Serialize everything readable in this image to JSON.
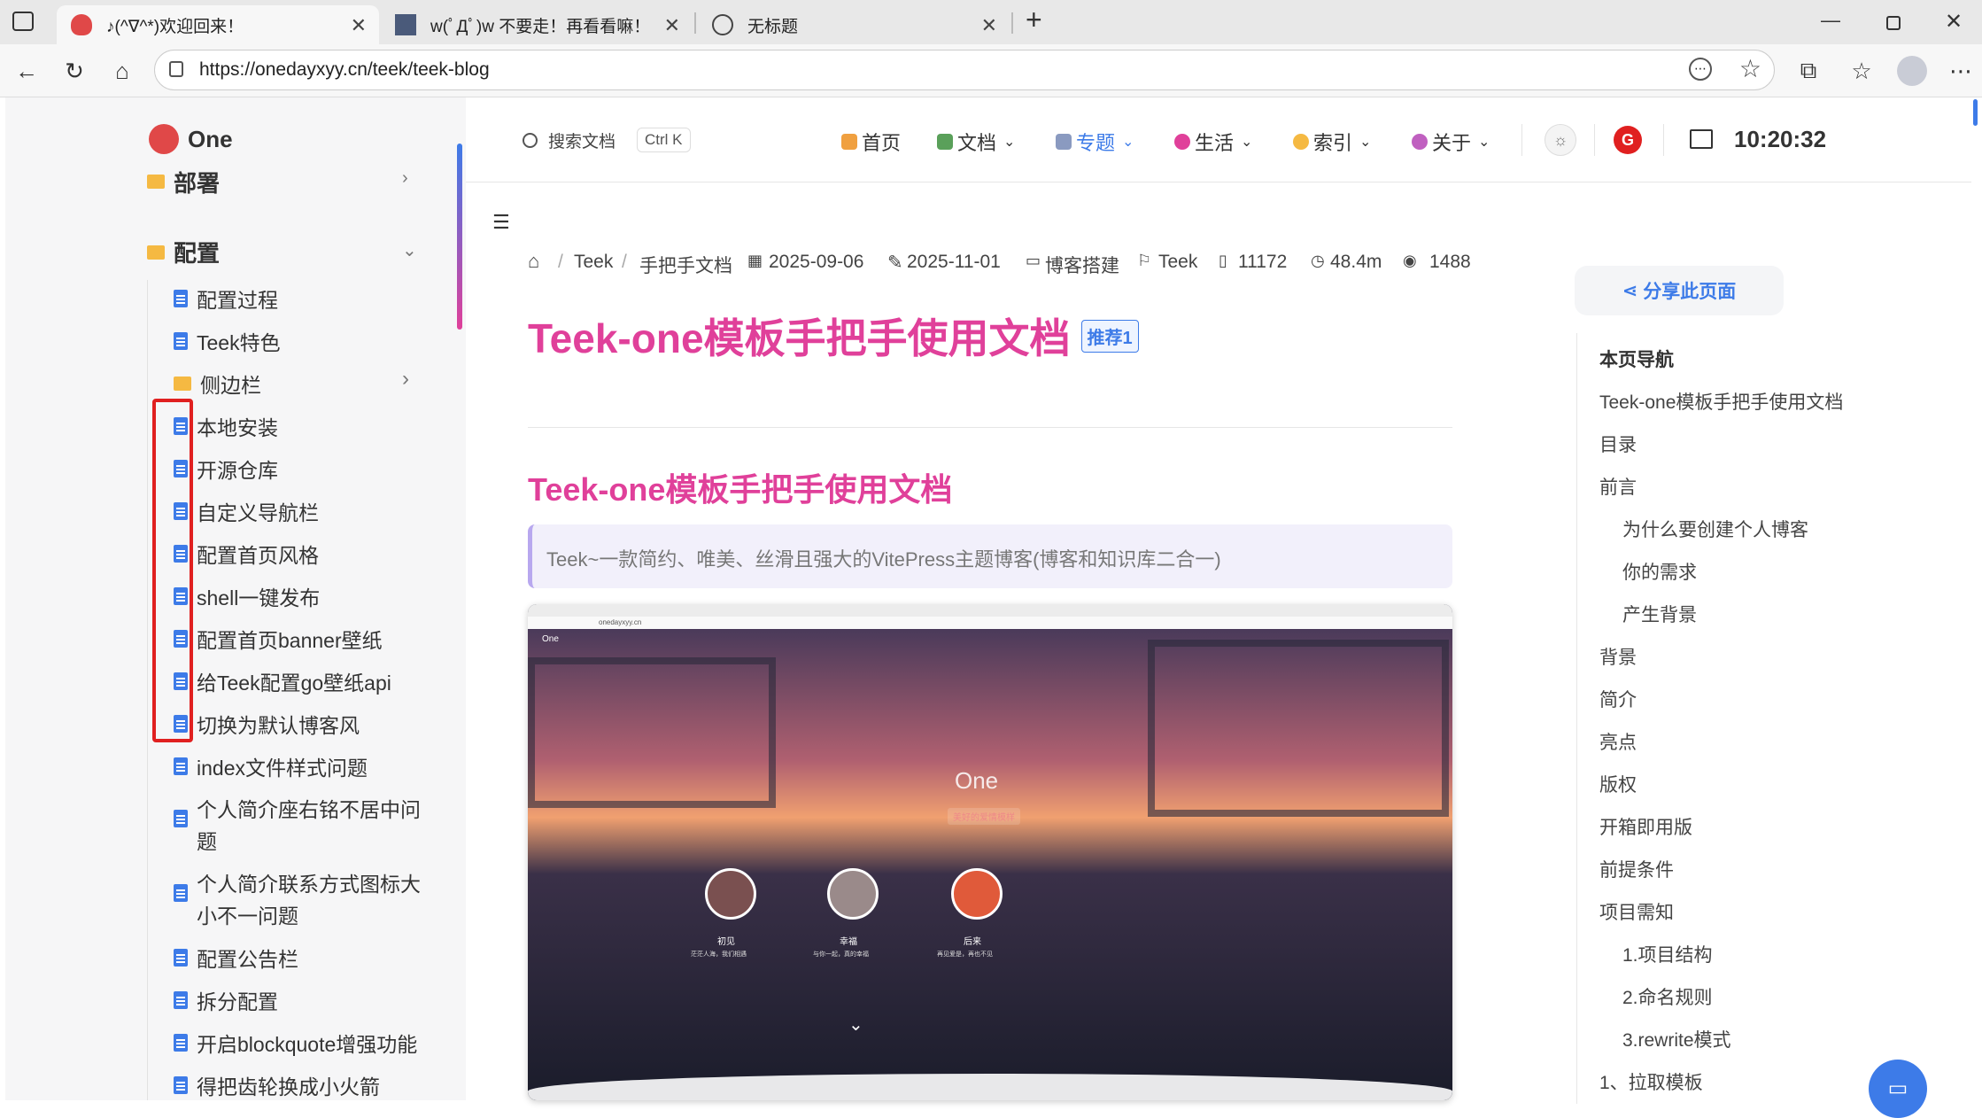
{
  "tabs": [
    {
      "title": "♪(^∇^*)欢迎回来！"
    },
    {
      "title": "w(ﾟДﾟ)w 不要走！再看看嘛！"
    },
    {
      "title": "无标题"
    }
  ],
  "url": "https://onedayxyy.cn/teek/teek-blog",
  "site": {
    "name": "One"
  },
  "sidebar": {
    "partial": "部署",
    "group": "配置",
    "items": [
      "配置过程",
      "Teek特色",
      "侧边栏",
      "本地安装",
      "开源仓库",
      "自定义导航栏",
      "配置首页风格",
      "shell一键发布",
      "配置首页banner壁纸",
      "给Teek配置go壁纸api",
      "切换为默认博客风",
      "index文件样式问题",
      "个人简介座右铭不居中问",
      "题",
      "个人简介联系方式图标大",
      "小不一问题",
      "配置公告栏",
      "拆分配置",
      "开启blockquote增强功能",
      "得把齿轮换成小火箭"
    ]
  },
  "header": {
    "search": "搜索文档",
    "shortcut": "Ctrl K",
    "nav": [
      "首页",
      "文档",
      "专题",
      "生活",
      "索引",
      "关于"
    ],
    "time": "10:20:32"
  },
  "breadcrumb": {
    "a": "Teek",
    "b": "手把手文档"
  },
  "meta": {
    "created": "2025-09-06",
    "updated": "2025-11-01",
    "category": "博客搭建",
    "tag": "Teek",
    "words": "11172",
    "read": "48.4m",
    "views": "1488"
  },
  "article": {
    "title": "Teek-one模板手把手使用文档",
    "badge": "推荐1",
    "h2": "Teek-one模板手把手使用文档",
    "quote": "Teek~一款简约、唯美、丝滑且强大的VitePress主题博客(博客和知识库二合一)",
    "shot": {
      "site": "One",
      "url": "onedayxyy.cn",
      "hero": "One",
      "sub": "美好的爱情模样",
      "cards": [
        {
          "t": "初见",
          "d": "茫茫人海，我们相遇"
        },
        {
          "t": "幸福",
          "d": "与你一起，真的幸福"
        },
        {
          "t": "后来",
          "d": "再见爱是，再也不见"
        }
      ]
    }
  },
  "share": "分享此页面",
  "toc": {
    "title": "本页导航",
    "items": [
      "Teek-one模板手把手使用文档",
      "目录",
      "前言",
      "为什么要创建个人博客",
      "你的需求",
      "产生背景",
      "背景",
      "简介",
      "亮点",
      "版权",
      "开箱即用版",
      "前提条件",
      "项目需知",
      "1.项目结构",
      "2.命名规则",
      "3.rewrite模式",
      "1、拉取模板"
    ]
  },
  "colors": {
    "accent": "#e0409a",
    "link": "#3d7be8",
    "highlight": "#e02020"
  }
}
